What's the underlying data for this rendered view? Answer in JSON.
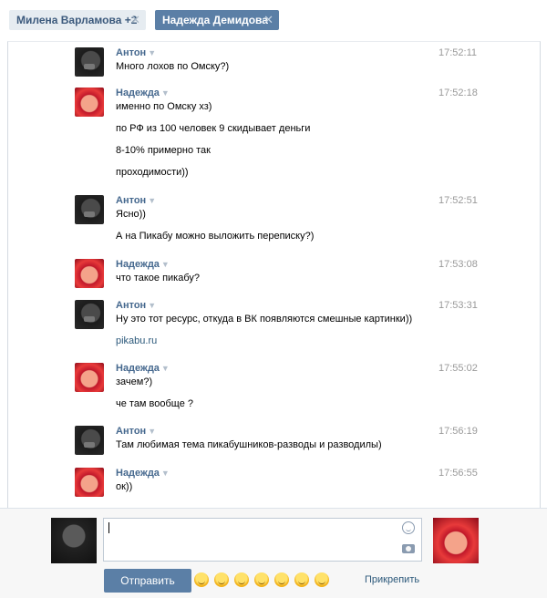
{
  "tabs": [
    {
      "label": "Милена Варламова +2",
      "close": "✕"
    },
    {
      "label": "Надежда Демидова",
      "close": "✕"
    }
  ],
  "messages": [
    {
      "author": "Антон",
      "time": "17:52:11",
      "avatar": "anton",
      "lines": [
        "Много лохов по Омску?)"
      ]
    },
    {
      "author": "Надежда",
      "time": "17:52:18",
      "avatar": "nadezhda",
      "lines": [
        "именно по Омску хз)",
        "по РФ из 100 человек 9 скидывает деньги",
        "8-10% примерно так",
        "проходимости))"
      ]
    },
    {
      "author": "Антон",
      "time": "17:52:51",
      "avatar": "anton",
      "lines": [
        "Ясно))",
        "А на Пикабу можно выложить переписку?)"
      ]
    },
    {
      "author": "Надежда",
      "time": "17:53:08",
      "avatar": "nadezhda",
      "lines": [
        "что такое пикабу?"
      ]
    },
    {
      "author": "Антон",
      "time": "17:53:31",
      "avatar": "anton",
      "lines": [
        "Ну это тот ресурс, откуда в ВК появляются смешные картинки))",
        "pikabu.ru"
      ]
    },
    {
      "author": "Надежда",
      "time": "17:55:02",
      "avatar": "nadezhda",
      "lines": [
        "зачем?)",
        "че там вообще ?"
      ]
    },
    {
      "author": "Антон",
      "time": "17:56:19",
      "avatar": "anton",
      "lines": [
        "Там любимая тема пикабушников-разводы и разводилы)"
      ]
    },
    {
      "author": "Надежда",
      "time": "17:56:55",
      "avatar": "nadezhda",
      "lines": [
        "ок))"
      ]
    }
  ],
  "compose": {
    "send_label": "Отправить",
    "attach_label": "Прикрепить",
    "emojis": [
      "grin-emoji",
      "relieved-emoji",
      "laugh-tears-emoji",
      "blush-emoji",
      "flushed-emoji",
      "wink-emoji",
      "heart-eyes-emoji"
    ]
  },
  "colors": {
    "accent": "#5b7fa6",
    "name": "#45688e",
    "link": "#2b587a"
  },
  "icons": {
    "tab_close": "close-icon",
    "name_menu": "chevron-down-icon",
    "smile": "smile-icon",
    "camera": "camera-icon"
  }
}
